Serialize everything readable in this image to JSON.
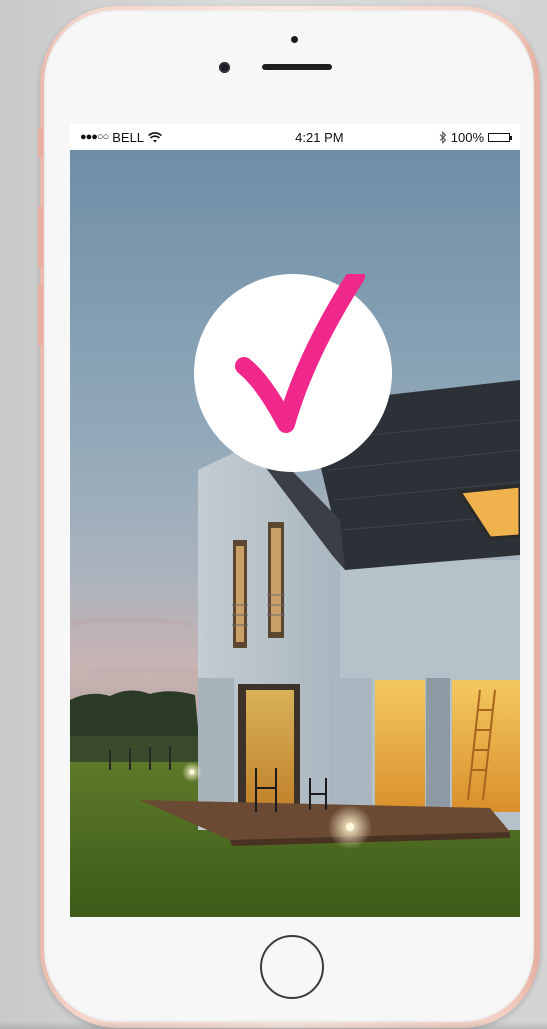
{
  "status_bar": {
    "signal_dots": "●●●○○",
    "carrier": "BELL",
    "wifi_icon": "wifi-icon",
    "time": "4:21 PM",
    "bluetooth_icon": "bluetooth-icon",
    "battery_percent": "100%",
    "battery_level": 1.0
  },
  "overlay": {
    "check_icon": "checkmark-icon",
    "check_color": "#f0288c"
  },
  "photo": {
    "subject": "house-exterior-dusk-photo"
  },
  "colors": {
    "phone_frame": "#f4d3c8",
    "phone_face": "#f7f7f7",
    "status_bar_bg": "#ffffff"
  }
}
